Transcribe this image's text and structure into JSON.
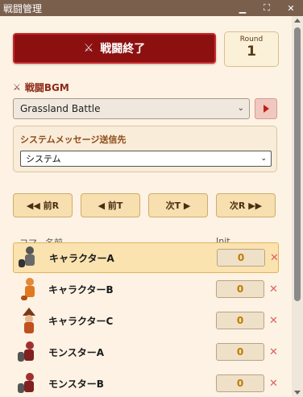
{
  "window": {
    "title": "戦闘管理"
  },
  "controls": {
    "end_battle": "戦闘終了",
    "round_label": "Round",
    "round_value": "1"
  },
  "bgm": {
    "label": "戦闘BGM",
    "selected": "Grassland Battle"
  },
  "message": {
    "label": "システムメッセージ送信先",
    "selected": "システム"
  },
  "nav": {
    "prev_round": "◀◀ 前R",
    "prev_turn": "◀ 前T",
    "next_turn": "次T ▶",
    "next_round": "次R ▶▶"
  },
  "table": {
    "col_piece": "コマ",
    "col_name": "名前",
    "col_init": "Init",
    "rows": [
      {
        "name": "キャラクターA",
        "init": "0",
        "active": true,
        "sprite": "knight"
      },
      {
        "name": "キャラクターB",
        "init": "0",
        "active": false,
        "sprite": "dancer"
      },
      {
        "name": "キャラクターC",
        "init": "0",
        "active": false,
        "sprite": "mage"
      },
      {
        "name": "モンスターA",
        "init": "0",
        "active": false,
        "sprite": "warrior"
      },
      {
        "name": "モンスターB",
        "init": "0",
        "active": false,
        "sprite": "warrior"
      }
    ]
  },
  "colors": {
    "accent": "#8d1010",
    "title_bar": "#7a5f4d",
    "init_value": "#c07800"
  }
}
